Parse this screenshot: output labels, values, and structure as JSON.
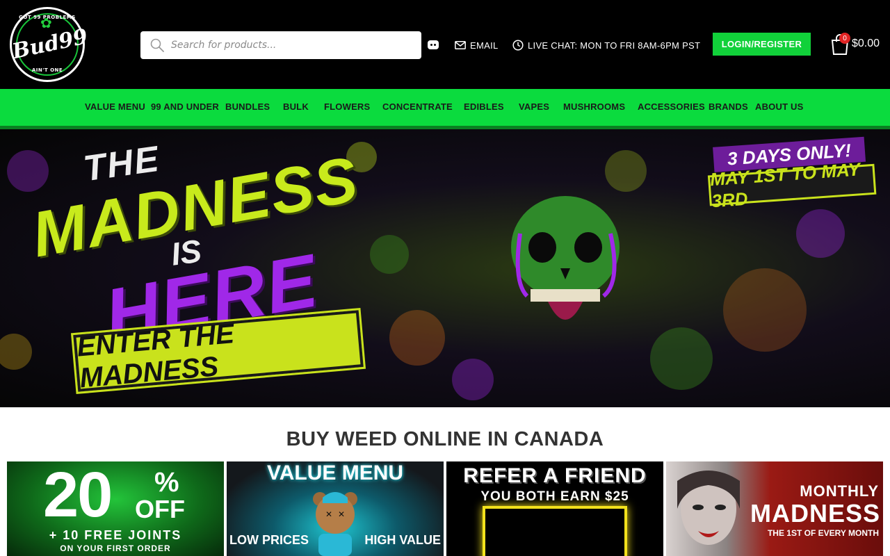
{
  "header": {
    "logo": {
      "top_text": "GOT 99 PROBLEMS",
      "brand": "Bud99",
      "bottom_text": "AIN'T ONE"
    },
    "search": {
      "placeholder": "Search for products..."
    },
    "email_label": "EMAIL",
    "live_chat_label": "LIVE CHAT: MON TO FRI 8AM-6PM PST",
    "login_label": "LOGIN/REGISTER",
    "cart": {
      "count": "0",
      "total": "$0.00"
    }
  },
  "nav": {
    "items": [
      "VALUE MENU",
      "99 AND UNDER",
      "BUNDLES",
      "BULK",
      "FLOWERS",
      "CONCENTRATE",
      "EDIBLES",
      "VAPES",
      "MUSHROOMS",
      "ACCESSORIES",
      "BRANDS",
      "ABOUT US"
    ]
  },
  "hero": {
    "line_the": "THE",
    "line_madness": "MADNESS",
    "line_is": "IS",
    "line_here": "HERE",
    "cta": "ENTER THE MADNESS",
    "days_only": "3 DAYS ONLY!",
    "dates": "MAY 1ST TO MAY 3RD"
  },
  "main": {
    "section_title": "BUY WEED ONLINE IN CANADA"
  },
  "promos": {
    "p1": {
      "percent": "20",
      "percent_sign": "%",
      "off": "OFF",
      "joints": "+ 10 FREE JOINTS",
      "order": "ON YOUR FIRST ORDER"
    },
    "p2": {
      "title": "VALUE MENU",
      "low": "LOW PRICES",
      "high": "HIGH VALUE"
    },
    "p3": {
      "title": "REFER A FRIEND",
      "subtitle": "YOU BOTH EARN $25"
    },
    "p4": {
      "monthly": "MONTHLY",
      "madness": "MADNESS",
      "first": "THE 1ST OF EVERY MONTH"
    }
  },
  "colors": {
    "nav_green": "#0bdb3e",
    "login_green": "#11d13a",
    "hero_lime": "#c8ea1c",
    "hero_purple": "#a028e8",
    "badge_red": "#e02424"
  }
}
